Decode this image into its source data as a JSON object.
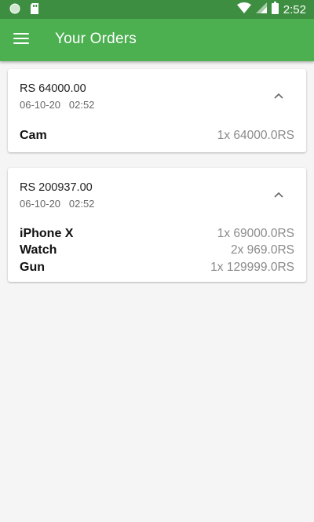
{
  "status_bar": {
    "time": "2:52",
    "icons": [
      "circle-notification-icon",
      "sd-card-icon",
      "wifi-icon",
      "cell-signal-icon",
      "battery-icon"
    ]
  },
  "app_bar": {
    "title": "Your Orders",
    "menu_icon": "hamburger-menu-icon",
    "color": "#4caf50",
    "status_color": "#3e8e41"
  },
  "orders": [
    {
      "total": "RS 64000.00",
      "date": "06-10-20   02:52",
      "toggle_icon": "chevron-up-icon",
      "items": [
        {
          "name": "Cam",
          "qty": "1x 64000.0RS"
        }
      ]
    },
    {
      "total": "RS 200937.00",
      "date": "06-10-20   02:52",
      "toggle_icon": "chevron-up-icon",
      "items": [
        {
          "name": "iPhone X",
          "qty": "1x 69000.0RS"
        },
        {
          "name": "Watch",
          "qty": "2x 969.0RS"
        },
        {
          "name": "Gun",
          "qty": "1x 129999.0RS"
        }
      ]
    }
  ]
}
